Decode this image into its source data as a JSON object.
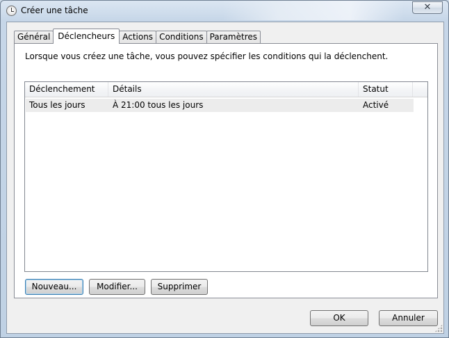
{
  "window": {
    "title": "Créer une tâche",
    "close_glyph": "✕",
    "icon": "task-clock-icon"
  },
  "tabs": [
    {
      "label": "Général"
    },
    {
      "label": "Déclencheurs",
      "active": true
    },
    {
      "label": "Actions"
    },
    {
      "label": "Conditions"
    },
    {
      "label": "Paramètres"
    }
  ],
  "panel": {
    "description": "Lorsque vous créez une tâche, vous pouvez spécifier les conditions qui la déclenchent."
  },
  "triggers_table": {
    "columns": [
      "Déclenchement",
      "Détails",
      "Statut"
    ],
    "rows": [
      [
        "Tous les jours",
        "À 21:00 tous les jours",
        "Activé"
      ]
    ]
  },
  "panel_buttons": {
    "new": "Nouveau...",
    "edit": "Modifier...",
    "delete": "Supprimer"
  },
  "dialog_buttons": {
    "ok": "OK",
    "cancel": "Annuler"
  },
  "colors": {
    "frame": "#c6d6e8",
    "client_bg": "#f0f0f0",
    "selected_row": "#ececec",
    "default_button_border": "#3c7fb1"
  }
}
